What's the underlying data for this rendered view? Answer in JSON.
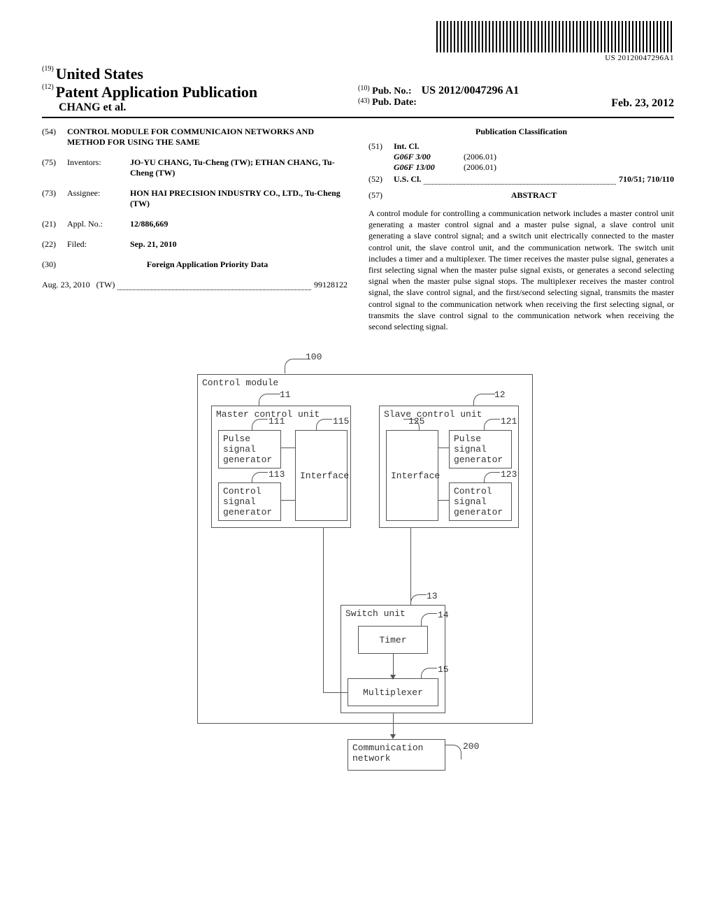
{
  "barcode_text": "US 20120047296A1",
  "header": {
    "country_code": "(19)",
    "country": "United States",
    "pub_code": "(12)",
    "pub_type": "Patent Application Publication",
    "authors": "CHANG et al.",
    "pub_no_code": "(10)",
    "pub_no_label": "Pub. No.:",
    "pub_no": "US 2012/0047296 A1",
    "pub_date_code": "(43)",
    "pub_date_label": "Pub. Date:",
    "pub_date": "Feb. 23, 2012"
  },
  "biblio": {
    "title_code": "(54)",
    "title": "CONTROL MODULE FOR COMMUNICAION NETWORKS AND METHOD FOR USING THE SAME",
    "inventors_code": "(75)",
    "inventors_label": "Inventors:",
    "inventors": "JO-YU CHANG, Tu-Cheng (TW); ETHAN CHANG, Tu-Cheng (TW)",
    "assignee_code": "(73)",
    "assignee_label": "Assignee:",
    "assignee": "HON HAI PRECISION INDUSTRY CO., LTD., Tu-Cheng (TW)",
    "appl_no_code": "(21)",
    "appl_no_label": "Appl. No.:",
    "appl_no": "12/886,669",
    "filed_code": "(22)",
    "filed_label": "Filed:",
    "filed": "Sep. 21, 2010",
    "foreign_code": "(30)",
    "foreign_header": "Foreign Application Priority Data",
    "foreign_date": "Aug. 23, 2010",
    "foreign_country": "(TW)",
    "foreign_num": "99128122"
  },
  "classification": {
    "header": "Publication Classification",
    "intcl_code": "(51)",
    "intcl_label": "Int. Cl.",
    "intcl_1_code": "G06F 3/00",
    "intcl_1_ver": "(2006.01)",
    "intcl_2_code": "G06F 13/00",
    "intcl_2_ver": "(2006.01)",
    "uscl_code": "(52)",
    "uscl_label": "U.S. Cl.",
    "uscl_value": "710/51; 710/110",
    "abstract_code": "(57)",
    "abstract_label": "ABSTRACT",
    "abstract_text": "A control module for controlling a communication network includes a master control unit generating a master control signal and a master pulse signal, a slave control unit generating a slave control signal; and a switch unit electrically connected to the master control unit, the slave control unit, and the communication network. The switch unit includes a timer and a multiplexer. The timer receives the master pulse signal, generates a first selecting signal when the master pulse signal exists, or generates a second selecting signal when the master pulse signal stops. The multiplexer receives the master control signal, the slave control signal, and the first/second selecting signal, transmits the master control signal to the communication network when receiving the first selecting signal, or transmits the slave control signal to the communication network when receiving the second selecting signal."
  },
  "diagram": {
    "ref_100": "100",
    "control_module": "Control module",
    "ref_11": "11",
    "master_control_unit": "Master control unit",
    "ref_111": "111",
    "pulse_signal_generator": "Pulse signal generator",
    "ref_115": "115",
    "interface": "Interface",
    "ref_113": "113",
    "control_signal_generator": "Control signal generator",
    "ref_12": "12",
    "slave_control_unit": "Slave control unit",
    "ref_125": "125",
    "ref_121": "121",
    "ref_123": "123",
    "ref_13": "13",
    "switch_unit": "Switch unit",
    "ref_14": "14",
    "timer": "Timer",
    "ref_15": "15",
    "multiplexer": "Multiplexer",
    "communication_network": "Communication network",
    "ref_200": "200"
  }
}
